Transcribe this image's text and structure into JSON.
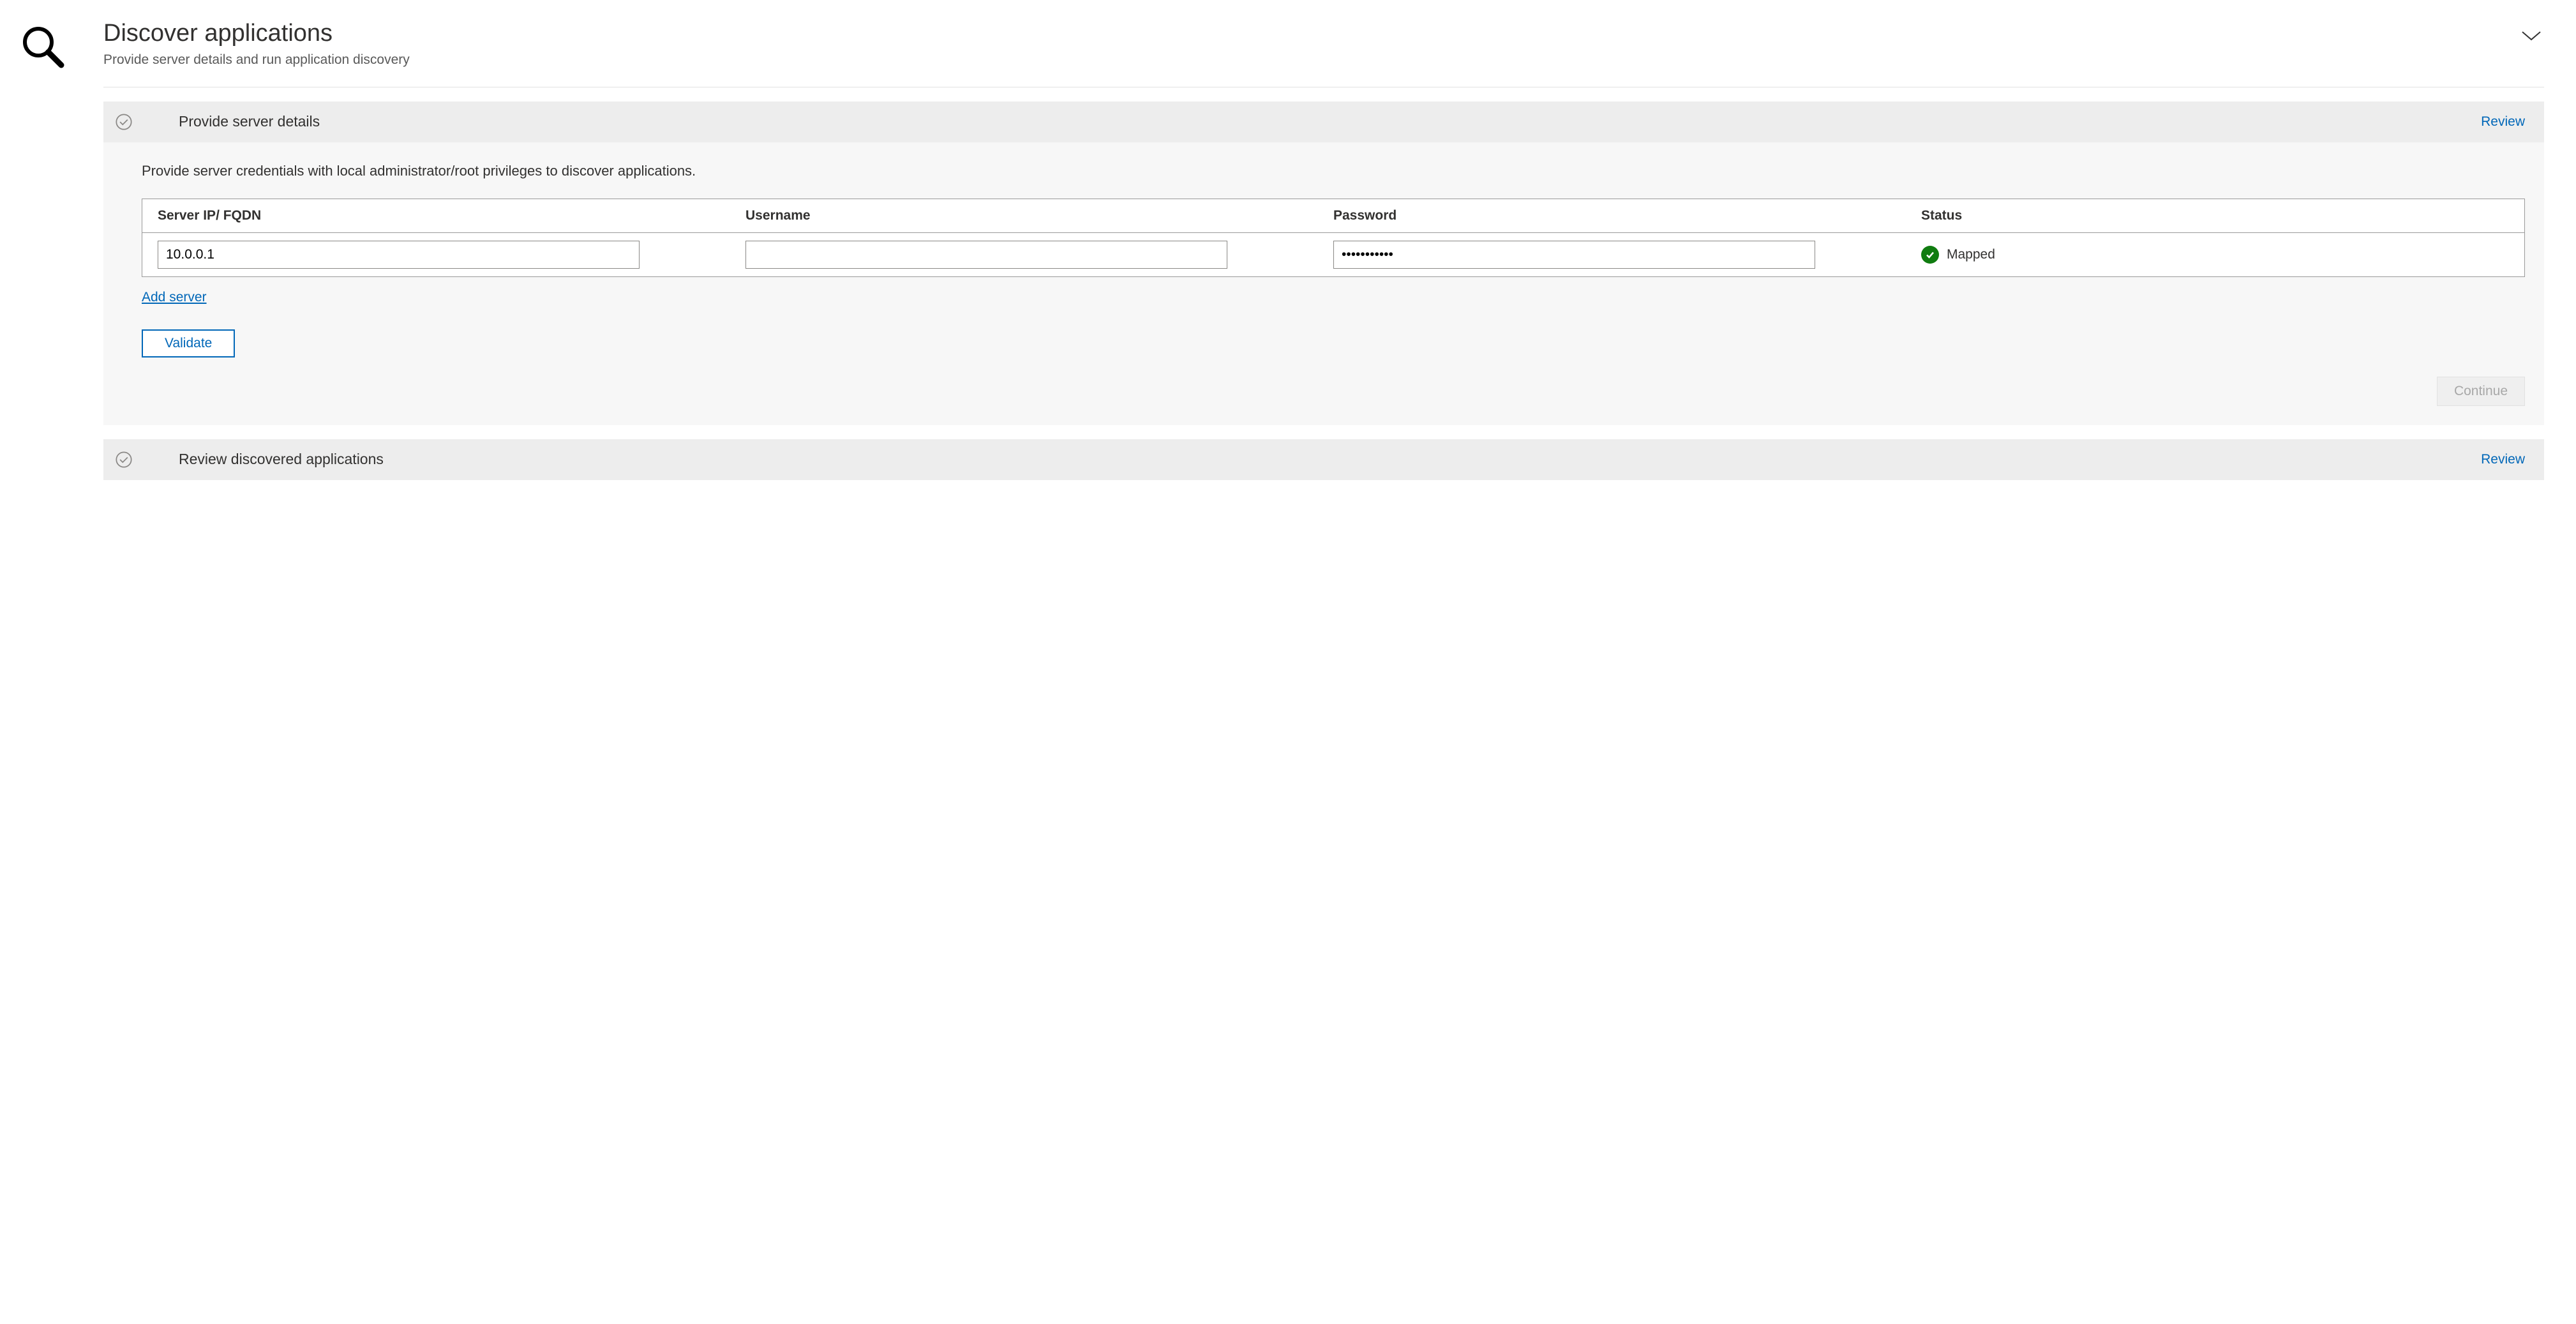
{
  "header": {
    "title": "Discover applications",
    "subtitle": "Provide server details and run application discovery"
  },
  "sections": {
    "provide": {
      "title": "Provide server details",
      "review_label": "Review",
      "description": "Provide server credentials with local administrator/root privileges to discover applications.",
      "columns": {
        "ip": "Server IP/ FQDN",
        "username": "Username",
        "password": "Password",
        "status": "Status"
      },
      "row": {
        "ip_value": "10.0.0.1",
        "username_value": "",
        "password_value": "•••••••••••",
        "status_text": "Mapped"
      },
      "add_server_label": "Add server",
      "validate_label": "Validate",
      "continue_label": "Continue"
    },
    "review": {
      "title": "Review discovered applications",
      "review_label": "Review"
    }
  }
}
